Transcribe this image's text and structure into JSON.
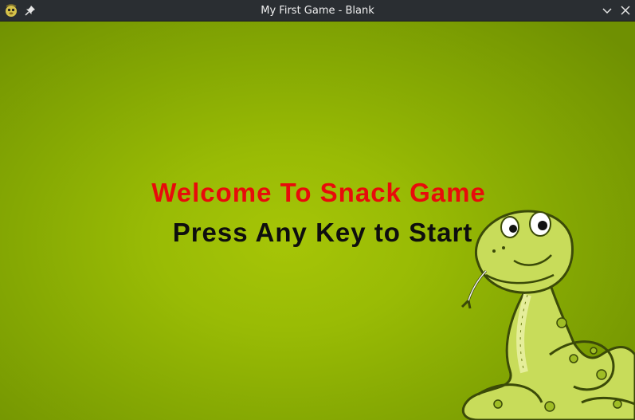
{
  "window": {
    "title": "My First Game - Blank"
  },
  "titlebar": {
    "app_icon": "pygame-snake-icon",
    "pin_icon": "pin-icon",
    "minimize_icon": "chevron-down-icon",
    "close_icon": "close-icon"
  },
  "game": {
    "welcome_text": "Welcome To Snack Game",
    "start_prompt": "Press Any Key to Start",
    "colors": {
      "background": "#99bb05",
      "welcome": "#e80b0b",
      "prompt": "#0e0e0e"
    },
    "mascot": "cartoon-snake"
  }
}
